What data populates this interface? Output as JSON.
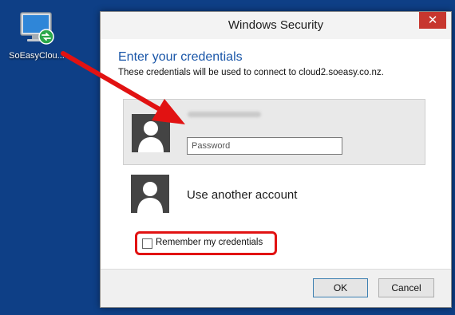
{
  "desktop": {
    "shortcut_label": "SoEasyClou..."
  },
  "dialog": {
    "title": "Windows Security",
    "close_symbol": "✕",
    "heading": "Enter your credentials",
    "subheading": "These credentials will be used to connect to cloud2.soeasy.co.nz.",
    "password_placeholder": "Password",
    "other_account_label": "Use another account",
    "remember_label": "Remember my credentials",
    "ok_label": "OK",
    "cancel_label": "Cancel"
  },
  "icons": [
    "remote-desktop-icon",
    "user-avatar-icon",
    "close-icon",
    "annotation-arrow"
  ],
  "colors": {
    "desktop_bg": "#0e3f86",
    "heading": "#1a56a8",
    "annotation": "#e11212",
    "close_button": "#c7372f"
  }
}
